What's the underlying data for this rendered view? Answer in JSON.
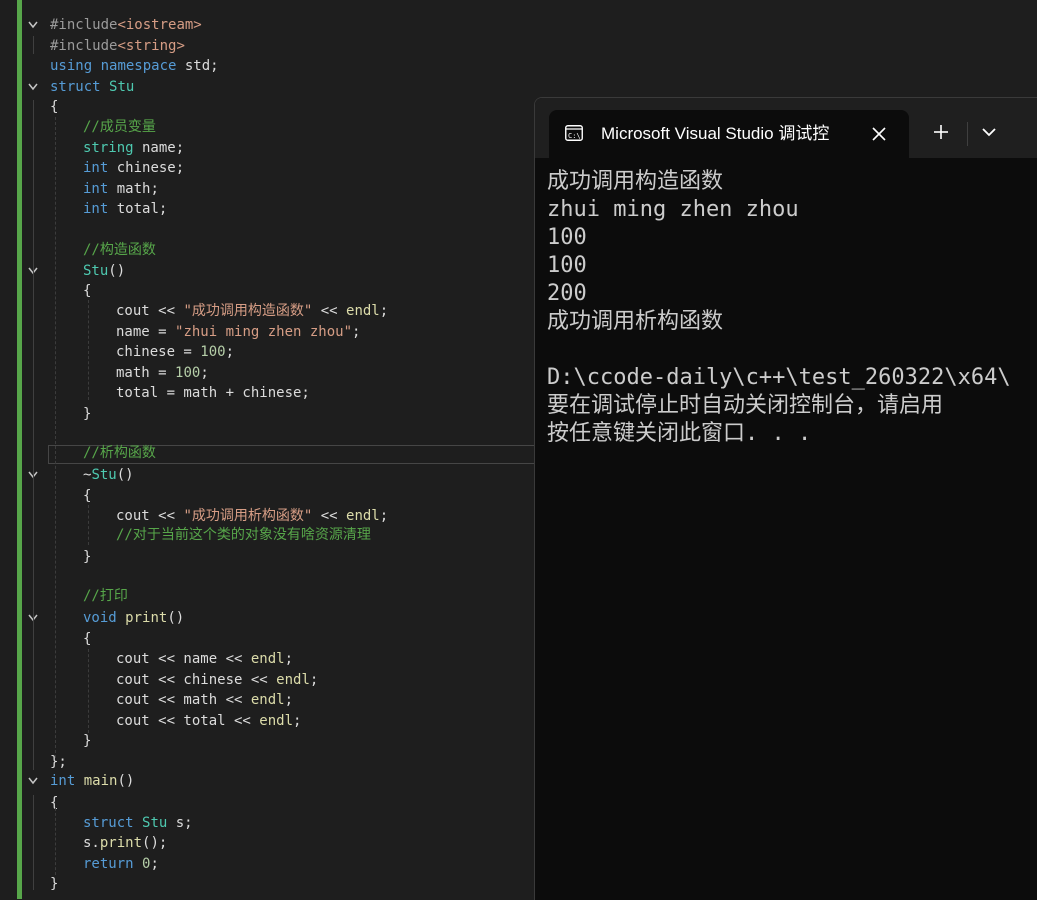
{
  "editor": {
    "lines": [
      {
        "parts": [
          [
            "pp",
            "#include"
          ],
          [
            "inc",
            "<iostream>"
          ]
        ]
      },
      {
        "parts": [
          [
            "pp",
            "#include"
          ],
          [
            "inc",
            "<string>"
          ]
        ]
      },
      {
        "parts": [
          [
            "kw",
            "using"
          ],
          [
            "var",
            " "
          ],
          [
            "kw",
            "namespace"
          ],
          [
            "var",
            " std;"
          ]
        ]
      },
      {
        "parts": [
          [
            "kw",
            "struct"
          ],
          [
            "var",
            " "
          ],
          [
            "ty",
            "Stu"
          ]
        ]
      },
      {
        "parts": [
          [
            "var",
            "{"
          ]
        ]
      },
      {
        "parts": [
          [
            "cm",
            "//成员变量"
          ]
        ]
      },
      {
        "parts": [
          [
            "ty",
            "string"
          ],
          [
            "var",
            " name;"
          ]
        ]
      },
      {
        "parts": [
          [
            "kw",
            "int"
          ],
          [
            "var",
            " chinese;"
          ]
        ]
      },
      {
        "parts": [
          [
            "kw",
            "int"
          ],
          [
            "var",
            " math;"
          ]
        ]
      },
      {
        "parts": [
          [
            "kw",
            "int"
          ],
          [
            "var",
            " total;"
          ]
        ]
      },
      {
        "parts": []
      },
      {
        "parts": [
          [
            "cm",
            "//构造函数"
          ]
        ]
      },
      {
        "parts": [
          [
            "ty",
            "Stu"
          ],
          [
            "var",
            "()"
          ]
        ]
      },
      {
        "parts": [
          [
            "var",
            "{"
          ]
        ]
      },
      {
        "parts": [
          [
            "var",
            "cout << "
          ],
          [
            "str",
            "\"成功调用构造函数\""
          ],
          [
            "var",
            " << "
          ],
          [
            "fn",
            "endl"
          ],
          [
            "var",
            ";"
          ]
        ]
      },
      {
        "parts": [
          [
            "var",
            "name = "
          ],
          [
            "str",
            "\"zhui ming zhen zhou\""
          ],
          [
            "var",
            ";"
          ]
        ]
      },
      {
        "parts": [
          [
            "var",
            "chinese = "
          ],
          [
            "num",
            "100"
          ],
          [
            "var",
            ";"
          ]
        ]
      },
      {
        "parts": [
          [
            "var",
            "math = "
          ],
          [
            "num",
            "100"
          ],
          [
            "var",
            ";"
          ]
        ]
      },
      {
        "parts": [
          [
            "var",
            "total = math + chinese;"
          ]
        ]
      },
      {
        "parts": [
          [
            "var",
            "}"
          ]
        ]
      },
      {
        "parts": []
      },
      {
        "parts": [
          [
            "cm",
            "//析构函数"
          ]
        ]
      },
      {
        "parts": [
          [
            "var",
            "~"
          ],
          [
            "ty",
            "Stu"
          ],
          [
            "var",
            "()"
          ]
        ]
      },
      {
        "parts": [
          [
            "var",
            "{"
          ]
        ]
      },
      {
        "parts": [
          [
            "var",
            "cout << "
          ],
          [
            "str",
            "\"成功调用析构函数\""
          ],
          [
            "var",
            " << "
          ],
          [
            "fn",
            "endl"
          ],
          [
            "var",
            ";"
          ]
        ]
      },
      {
        "parts": [
          [
            "cm",
            "//对于当前这个类的对象没有啥资源清理"
          ]
        ]
      },
      {
        "parts": [
          [
            "var",
            "}"
          ]
        ]
      },
      {
        "parts": []
      },
      {
        "parts": [
          [
            "cm",
            "//打印"
          ]
        ]
      },
      {
        "parts": [
          [
            "kw",
            "void"
          ],
          [
            "var",
            " "
          ],
          [
            "fn",
            "print"
          ],
          [
            "var",
            "()"
          ]
        ]
      },
      {
        "parts": [
          [
            "var",
            "{"
          ]
        ]
      },
      {
        "parts": [
          [
            "var",
            "cout << name << "
          ],
          [
            "fn",
            "endl"
          ],
          [
            "var",
            ";"
          ]
        ]
      },
      {
        "parts": [
          [
            "var",
            "cout << chinese << "
          ],
          [
            "fn",
            "endl"
          ],
          [
            "var",
            ";"
          ]
        ]
      },
      {
        "parts": [
          [
            "var",
            "cout << math << "
          ],
          [
            "fn",
            "endl"
          ],
          [
            "var",
            ";"
          ]
        ]
      },
      {
        "parts": [
          [
            "var",
            "cout << total << "
          ],
          [
            "fn",
            "endl"
          ],
          [
            "var",
            ";"
          ]
        ]
      },
      {
        "parts": [
          [
            "var",
            "}"
          ]
        ]
      },
      {
        "parts": [
          [
            "var",
            "};"
          ]
        ]
      },
      {
        "parts": [
          [
            "kw",
            "int"
          ],
          [
            "var",
            " "
          ],
          [
            "fn",
            "main"
          ],
          [
            "var",
            "()"
          ]
        ]
      },
      {
        "parts": [
          [
            "var",
            "{"
          ]
        ]
      },
      {
        "parts": [
          [
            "kw",
            "struct"
          ],
          [
            "var",
            " "
          ],
          [
            "ty",
            "Stu"
          ],
          [
            "var",
            " s;"
          ]
        ]
      },
      {
        "parts": [
          [
            "var",
            "s."
          ],
          [
            "fn",
            "print"
          ],
          [
            "var",
            "();"
          ]
        ]
      },
      {
        "parts": [
          [
            "kw",
            "return"
          ],
          [
            "var",
            " "
          ],
          [
            "num",
            "0"
          ],
          [
            "var",
            ";"
          ]
        ]
      },
      {
        "parts": [
          [
            "var",
            "}"
          ]
        ]
      }
    ]
  },
  "terminal": {
    "title": "Microsoft Visual Studio 调试控",
    "icon": "console-icon",
    "close_icon": "close-icon",
    "new_tab_icon": "plus-icon",
    "dropdown_icon": "chevron-down-icon",
    "output": [
      "成功调用构造函数",
      "zhui ming zhen zhou",
      "100",
      "100",
      "200",
      "成功调用析构函数",
      "",
      "D:\\ccode-daily\\c++\\test_260322\\x64\\",
      "要在调试停止时自动关闭控制台，请启用",
      "按任意键关闭此窗口. . ."
    ]
  },
  "colors": {
    "editor_bg": "#1e1e1e",
    "change_bar": "#57a64a",
    "keyword": "#569cd6",
    "type": "#4ec9b0",
    "function": "#dcdcaa",
    "string": "#d69d85",
    "comment": "#57a64a",
    "number": "#b5cea8",
    "terminal_bg": "#0c0c0c"
  }
}
